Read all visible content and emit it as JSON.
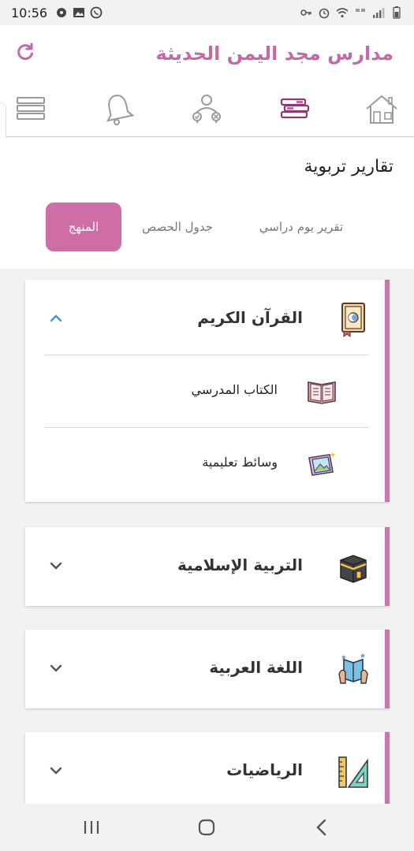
{
  "status_bar": {
    "time": "10:56",
    "left_icons": [
      "sync-icon",
      "image-icon",
      "whatsapp-icon"
    ],
    "right_icons": [
      "key-icon",
      "alarm-icon",
      "wifi-icon",
      "network-3g-icon",
      "signal-icon",
      "battery-icon"
    ]
  },
  "header": {
    "title": "مدارس مجد اليمن الحديثة",
    "refresh_icon": "refresh-icon",
    "accent_color": "#c26aa5"
  },
  "top_nav": {
    "items": [
      {
        "name": "home",
        "icon": "home-icon"
      },
      {
        "name": "books",
        "icon": "books-icon",
        "active": true
      },
      {
        "name": "teacher",
        "icon": "teacher-icon"
      },
      {
        "name": "notifications",
        "icon": "bell-icon"
      },
      {
        "name": "menu",
        "icon": "menu-icon"
      }
    ]
  },
  "section": {
    "title": "تقارير تربوية",
    "tabs": [
      {
        "label": "تقرير يوم دراسي",
        "active": false
      },
      {
        "label": "جدول الحصص",
        "active": false
      },
      {
        "label": "المنهج",
        "active": true
      }
    ],
    "tab_active_color": "#cf6ea4"
  },
  "subjects": [
    {
      "title": "القرآن الكريم",
      "icon": "quran-icon",
      "expanded": true,
      "items": [
        {
          "label": "الكتاب المدرسي",
          "icon": "open-book-icon"
        },
        {
          "label": "وسائط تعليمية",
          "icon": "media-icon"
        }
      ]
    },
    {
      "title": "التربية الإسلامية",
      "icon": "kaaba-icon",
      "expanded": false
    },
    {
      "title": "اللغة العربية",
      "icon": "reading-icon",
      "expanded": false
    },
    {
      "title": "الرياضيات",
      "icon": "ruler-triangle-icon",
      "expanded": false
    }
  ],
  "card_border_color": "#c877aa",
  "bottom_nav": {
    "items": [
      "recent-apps-icon",
      "home-circle-icon",
      "back-icon"
    ]
  }
}
